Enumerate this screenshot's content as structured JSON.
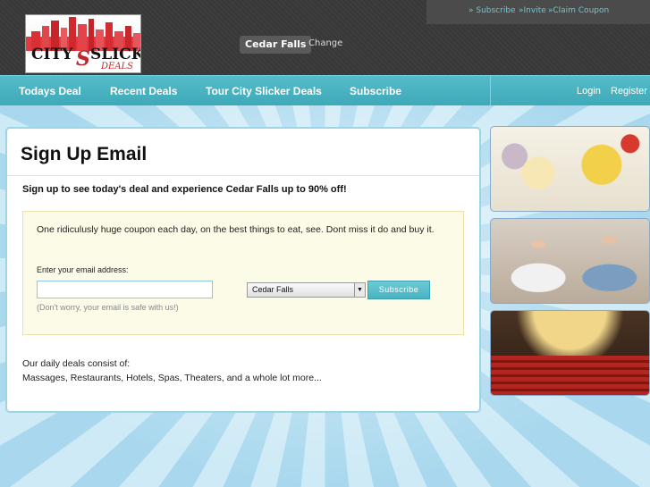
{
  "header": {
    "logo": {
      "line1": "CITY",
      "line1b": "SLICKER",
      "line2": "DEALS"
    },
    "city": "Cedar Falls",
    "change_label": "Change",
    "top_links": [
      "» Subscribe",
      "»Invite",
      "»Claim Coupon"
    ]
  },
  "nav": {
    "items": [
      "Todays Deal",
      "Recent Deals",
      "Tour City Slicker Deals",
      "Subscribe"
    ],
    "login": "Login",
    "register": "Register"
  },
  "main": {
    "title": "Sign Up Email",
    "tagline": "Sign up to see today's deal and experience Cedar Falls up to 90% off!",
    "promo": "One ridiculusly huge coupon each day, on the best things to eat, see. Dont miss it do and buy it.",
    "email_label": "Enter your email address:",
    "email_value": "",
    "safe_note": "(Don't worry, your email is safe with us!)",
    "city_select": "Cedar Falls",
    "subscribe_button": "Subscribe",
    "deals_heading": "Our daily deals consist of:",
    "deals_list": "Massages, Restaurants, Hotels, Spas, Theaters, and a whole lot more..."
  },
  "colors": {
    "nav_bg": "#49b3c1",
    "top_bg": "#3b3b3b",
    "link_accent": "#6fc6d3",
    "logo_red": "#c0272d"
  },
  "sidebar_photos": [
    "food-photo",
    "yoga-photo",
    "theater-photo"
  ]
}
